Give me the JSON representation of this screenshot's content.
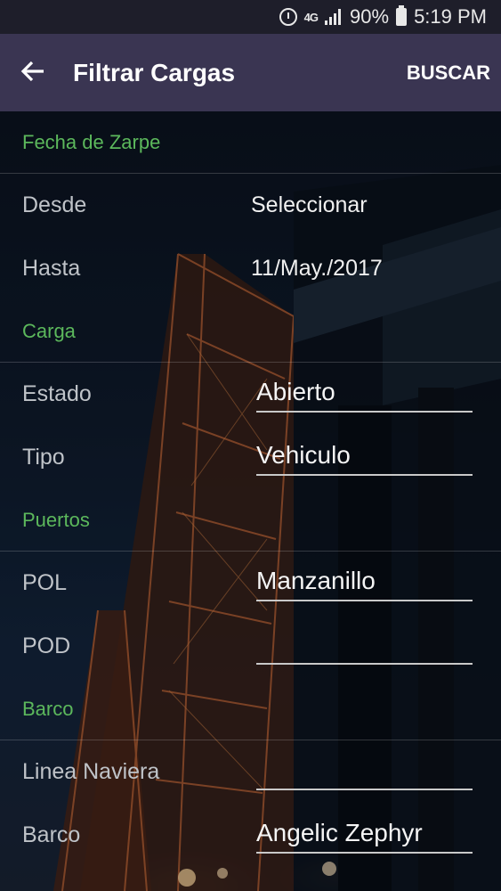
{
  "status_bar": {
    "network": "4G",
    "battery": "90%",
    "time": "5:19 PM",
    "icons": [
      "alarm-icon",
      "lte-icon",
      "signal-icon",
      "battery-icon"
    ]
  },
  "app_bar": {
    "title": "Filtrar Cargas",
    "action": "BUSCAR",
    "back_icon": "back-arrow-icon",
    "background": "#3a3552"
  },
  "colors": {
    "section_header": "#5cb85c",
    "label": "#bfc3c8"
  },
  "sections": {
    "fecha": {
      "header": "Fecha de Zarpe",
      "desde_label": "Desde",
      "desde_value": "Seleccionar",
      "hasta_label": "Hasta",
      "hasta_value": "11/May./2017"
    },
    "carga": {
      "header": "Carga",
      "estado_label": "Estado",
      "estado_value": "Abierto",
      "tipo_label": "Tipo",
      "tipo_value": "Vehiculo"
    },
    "puertos": {
      "header": "Puertos",
      "pol_label": "POL",
      "pol_value": "Manzanillo",
      "pod_label": "POD",
      "pod_value": ""
    },
    "barco": {
      "header": "Barco",
      "linea_label": "Linea Naviera",
      "linea_value": "",
      "barco_label": "Barco",
      "barco_value": "Angelic Zephyr"
    }
  }
}
